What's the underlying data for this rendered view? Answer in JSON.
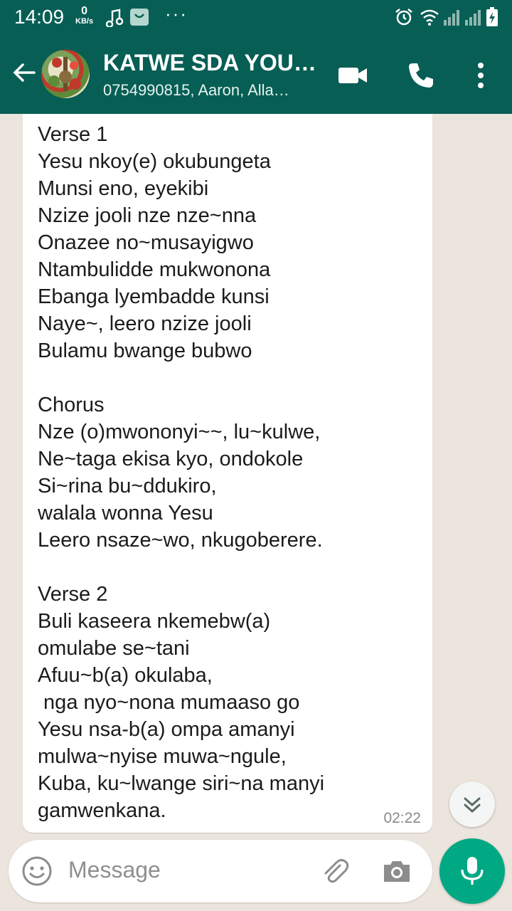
{
  "status_bar": {
    "time": "14:09",
    "net_speed_value": "0",
    "net_speed_unit": "KB/s",
    "icons": [
      "music-note-icon",
      "shopping-bag-icon",
      "more-dots-icon",
      "alarm-icon",
      "wifi-icon",
      "signal-icon",
      "battery-icon"
    ]
  },
  "header": {
    "title": "KATWE SDA YOU…",
    "subtitle": "0754990815, Aaron, Alla…",
    "actions": [
      "video-call-icon",
      "voice-call-icon",
      "overflow-menu-icon"
    ]
  },
  "message": {
    "text": "Verse 1\nYesu nkoy(e) okubungeta\nMunsi eno, eyekibi\nNzize jooli nze nze~nna\nOnazee no~musayigwo\nNtambulidde mukwonona\nEbanga lyembadde kunsi\nNaye~, leero nzize jooli\nBulamu bwange bubwo\n\nChorus\nNze (o)mwononyi~~, lu~kulwe,\nNe~taga ekisa kyo, ondokole\nSi~rina bu~ddukiro,\nwalala wonna Yesu\nLeero nsaze~wo, nkugoberere.\n\nVerse 2\nBuli kaseera nkemebw(a)\nomulabe se~tani\nAfuu~b(a) okulaba,\n nga nyo~nona mumaaso go\nYesu nsa-b(a) ompa amanyi\nmulwa~nyise muwa~ngule,\nKuba, ku~lwange siri~na manyi\ngamwenkana.",
    "time": "02:22"
  },
  "input": {
    "placeholder": "Message"
  },
  "colors": {
    "header_bg": "#075e54",
    "chat_bg": "#ece5dd",
    "mic_bg": "#00a884"
  }
}
